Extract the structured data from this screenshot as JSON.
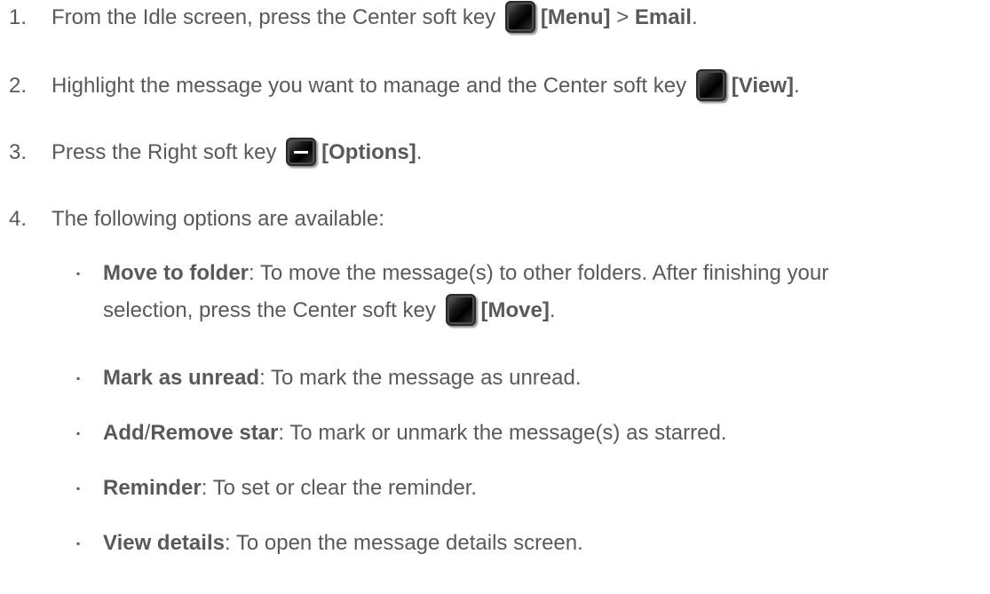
{
  "steps": [
    {
      "number": "1.",
      "pre": "From the Idle screen, press the Center soft key",
      "key_icon": "center-soft-key-icon",
      "bold1": "[Menu]",
      "sep": " > ",
      "bold2": "Email",
      "post": "."
    },
    {
      "number": "2.",
      "pre": "Highlight the message you want to manage and the Center soft key",
      "key_icon": "center-soft-key-icon",
      "bold1": "[View]",
      "post": "."
    },
    {
      "number": "3.",
      "pre": "Press the Right soft key",
      "key_icon": "right-soft-key-icon",
      "bold1": "[Options]",
      "post": "."
    },
    {
      "number": "4.",
      "pre": "The following options are available:"
    }
  ],
  "options": [
    {
      "marker": "▪",
      "term": "Move to folder",
      "text_line1": ": To move the message(s) to other folders. After finishing your",
      "text_line2": "selection, press the Center soft key",
      "key_icon": "center-soft-key-icon",
      "bold_after": "[Move]",
      "post": "."
    },
    {
      "marker": "▪",
      "term": "Mark as unread",
      "text": ": To mark the message as unread."
    },
    {
      "marker": "▪",
      "term_a": "Add",
      "slash": "/",
      "term_b": "Remove star",
      "text": ": To mark or unmark the message(s) as starred."
    },
    {
      "marker": "▪",
      "term": "Reminder",
      "text": ": To set or clear the reminder."
    },
    {
      "marker": "▪",
      "term": "View details",
      "text": ": To open the message details screen."
    }
  ]
}
